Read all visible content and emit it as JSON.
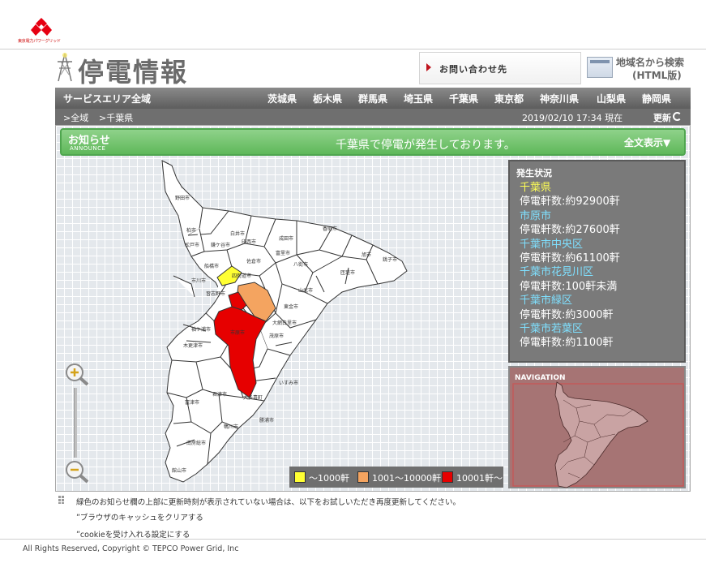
{
  "logo": {
    "text": "東京電力パワーグリッド"
  },
  "header": {
    "title": "停電情報",
    "contact_label": "お問い合わせ先",
    "search_line1": "地域名から検索",
    "search_line2": "(HTML版)"
  },
  "nav": {
    "all_label": "サービスエリア全域",
    "prefectures": [
      "茨城県",
      "栃木県",
      "群馬県",
      "埼玉県",
      "千葉県",
      "東京都",
      "神奈川県",
      "山梨県",
      "静岡県"
    ]
  },
  "breadcrumb": {
    "root": ">全域",
    "current": ">千葉県",
    "timestamp": "2019/02/10 17:34 現在",
    "update_label": "更新"
  },
  "announce": {
    "heading": "お知らせ",
    "sub": "ANNOUNCE",
    "message": "千葉県で停電が発生しております。",
    "full_label": "全文表示▼"
  },
  "status": {
    "heading": "発生状況",
    "pref": "千葉県",
    "pref_count": "停電軒数:約92900軒",
    "cities": [
      {
        "name": "市原市",
        "count": "停電軒数:約27600軒"
      },
      {
        "name": "千葉市中央区",
        "count": "停電軒数:約61100軒"
      },
      {
        "name": "千葉市花見川区",
        "count": "停電軒数:100軒未満"
      },
      {
        "name": "千葉市緑区",
        "count": "停電軒数:約3000軒"
      },
      {
        "name": "千葉市若葉区",
        "count": "停電軒数:約1100軒"
      }
    ]
  },
  "navigation": {
    "heading": "NAVIGATION"
  },
  "map": {
    "labels": [
      "野田市",
      "柏市",
      "松戸市",
      "市川市",
      "船橋市",
      "習志野市",
      "鎌ケ谷市",
      "白井市",
      "印西市",
      "成田市",
      "香取市",
      "旭市",
      "匝瑳市",
      "銚子市",
      "八街市",
      "佐倉市",
      "四街道市",
      "富里市",
      "山武市",
      "東金市",
      "大網白里市",
      "茂原市",
      "いすみ市",
      "大多喜町",
      "君津市",
      "富津市",
      "木更津市",
      "袖ケ浦市",
      "鴨川市",
      "南房総市",
      "館山市",
      "勝浦市",
      "市原市"
    ],
    "colors": {
      "yellow": "#ffff33",
      "orange": "#f4a460",
      "red": "#e60000"
    }
  },
  "legend": {
    "items": [
      {
        "label": "〜1000軒",
        "color": "#ffff33"
      },
      {
        "label": "1001〜10000軒",
        "color": "#f4a460"
      },
      {
        "label": "10001軒〜",
        "color": "#e60000"
      }
    ]
  },
  "footer": {
    "note": "緑色のお知らせ欄の上部に更新時刻が表示されていない場合は、以下をお試しいただき再度更新してください。",
    "bullet1": "ブラウザのキャッシュをクリアする",
    "bullet2": "cookieを受け入れる設定にする",
    "copyright": "All Rights Reserved, Copyright © TEPCO Power Grid, Inc"
  }
}
